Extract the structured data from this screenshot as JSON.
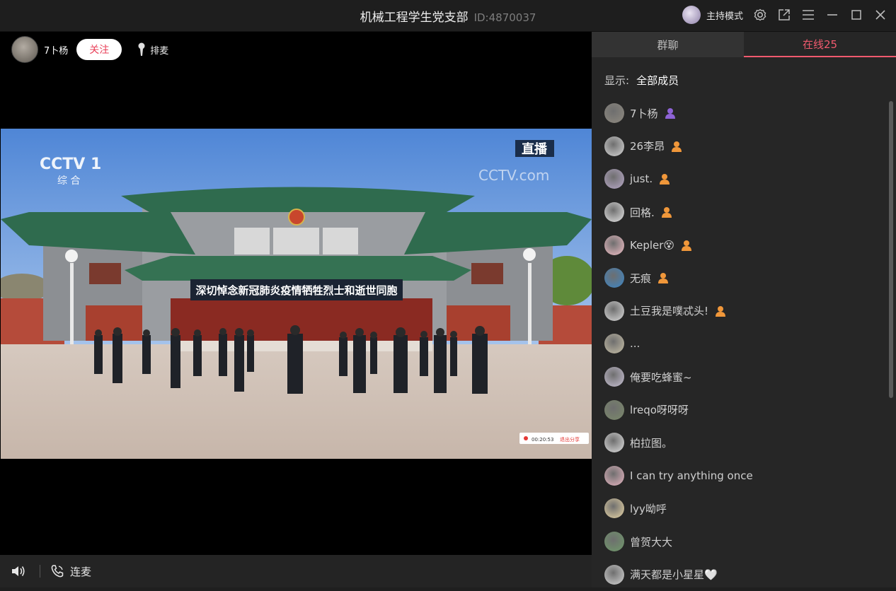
{
  "window": {
    "title": "机械工程学生党支部",
    "room_id": "ID:4870037",
    "host_mode_label": "主持模式"
  },
  "stage": {
    "host_name": "7卜杨",
    "follow_label": "关注",
    "queue_label": "排麦",
    "live_badge": "直播",
    "channel_logo": "CCTV 1",
    "channel_sub": "综 合",
    "watermark": "CCTV.com",
    "banner": "深切悼念新冠肺炎疫情牺牲烈士和逝世同胞",
    "rec_time": "00:20:53",
    "rec_exit": "退出分享"
  },
  "bottom": {
    "connect_label": "连麦"
  },
  "panel": {
    "tabs": [
      "群聊",
      "在线25"
    ],
    "filter_label": "显示:",
    "filter_value": "全部成员",
    "members": [
      {
        "name": "7卜杨",
        "badge": "host",
        "avatar": "#8f8a80"
      },
      {
        "name": "26李昂",
        "badge": "member",
        "avatar": "#d8d8d8"
      },
      {
        "name": "just.",
        "badge": "member",
        "avatar": "#b8a9c9"
      },
      {
        "name": "回格.",
        "badge": "member",
        "avatar": "#e6e6e6"
      },
      {
        "name": "Kepler😵",
        "badge": "member",
        "avatar": "#f3c0c8"
      },
      {
        "name": "无痕",
        "badge": "member",
        "avatar": "#3a86c8"
      },
      {
        "name": "土豆我是噗忒头!",
        "badge": "member",
        "avatar": "#dcdcdc"
      },
      {
        "name": "...",
        "badge": "",
        "avatar": "#c8c0a8"
      },
      {
        "name": "俺要吃蜂蜜~",
        "badge": "",
        "avatar": "#c9c2d6"
      },
      {
        "name": "lreqo呀呀呀",
        "badge": "",
        "avatar": "#7b8a6a"
      },
      {
        "name": "柏拉图。",
        "badge": "",
        "avatar": "#e0e0e0"
      },
      {
        "name": "I can try anything once",
        "badge": "",
        "avatar": "#e8b6c2"
      },
      {
        "name": "lyy呦呼",
        "badge": "",
        "avatar": "#e9d6a6"
      },
      {
        "name": "曾贺大大",
        "badge": "",
        "avatar": "#6f9a6a"
      },
      {
        "name": "满天都是小星星🤍",
        "badge": "",
        "avatar": "#d6d6d6"
      }
    ]
  }
}
